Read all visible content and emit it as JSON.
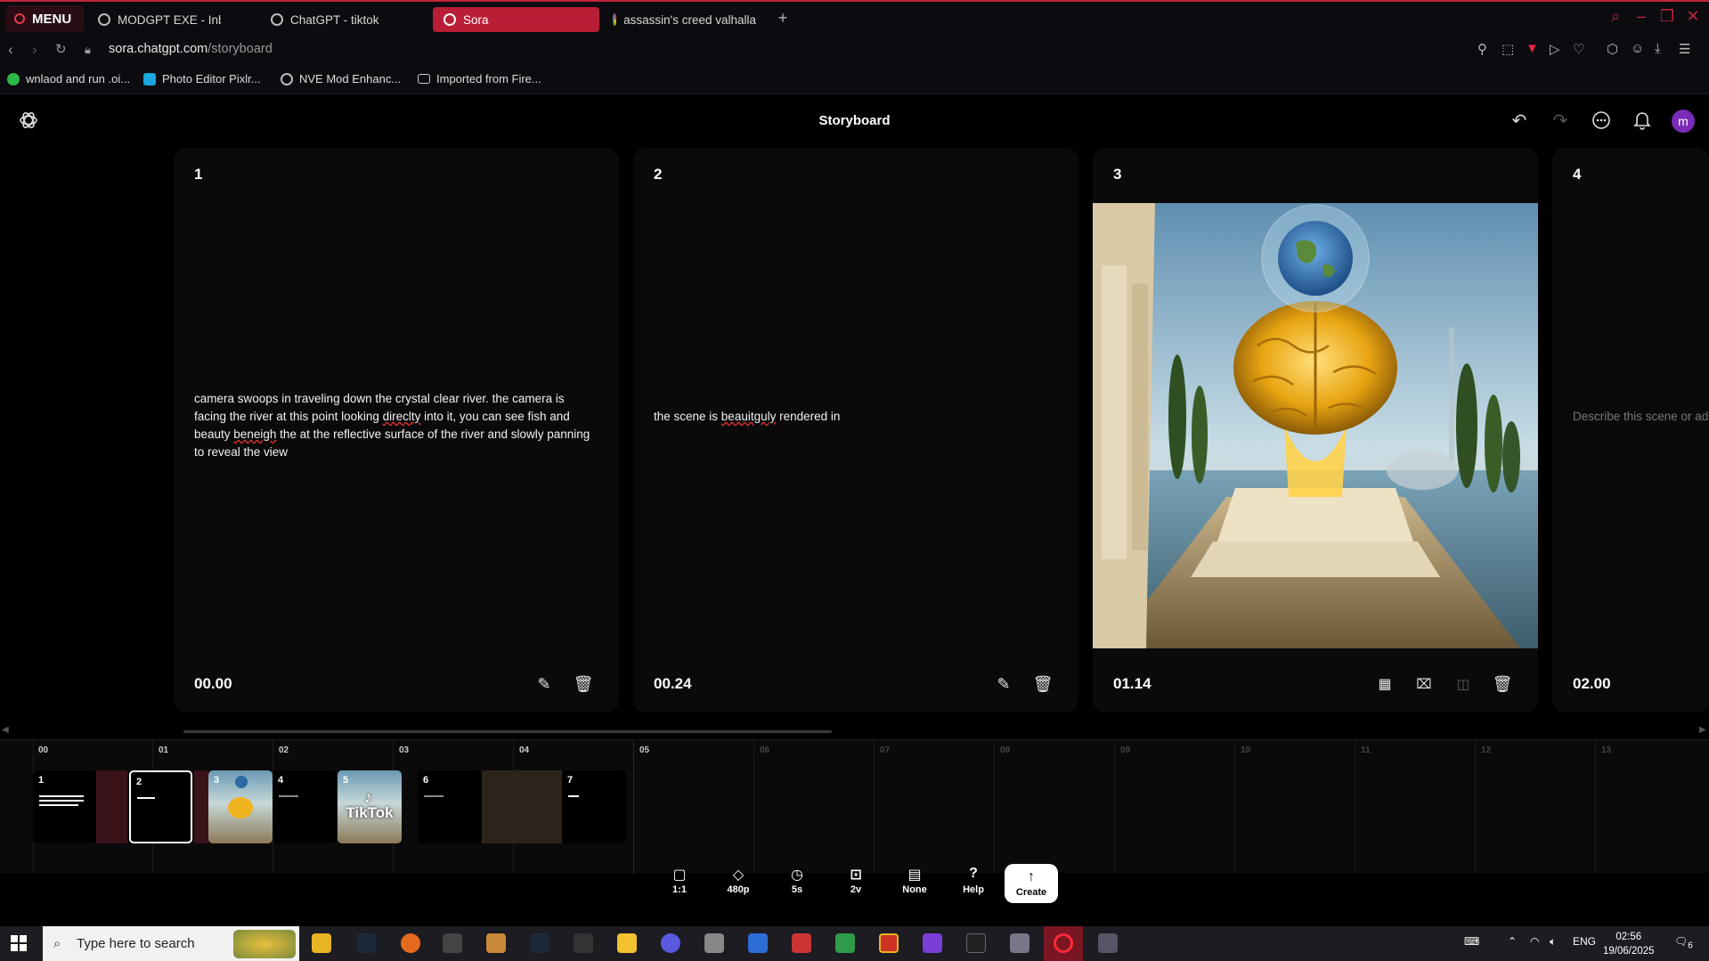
{
  "browser": {
    "menu_label": "MENU",
    "tabs": [
      {
        "title": "MODGPT EXE - Inbox tab"
      },
      {
        "title": "ChatGPT - tiktok"
      },
      {
        "title": "Sora"
      },
      {
        "title": "assassin's creed valhalla"
      }
    ],
    "url_domain": "sora.chatgpt.com",
    "url_path": "/storyboard",
    "bookmarks": [
      {
        "label": "wnlaod and run .oi...",
        "color": "#2fb84a"
      },
      {
        "label": "Photo Editor Pixlr...",
        "color": "#1aa7e0"
      },
      {
        "label": "NVE Mod Enhanc...",
        "color": "#bbbbbb"
      },
      {
        "label": "Imported from Fire...",
        "color": "#cccccc"
      }
    ],
    "accent": "#c0243a"
  },
  "header": {
    "title": "Storyboard",
    "avatar_letter": "m"
  },
  "cards": [
    {
      "number": "1",
      "prompt_parts": [
        "camera swoops in traveling down the crystal clear river. the camera is facing the river at this point looking ",
        "direclty",
        " into it, you can see fish and beauty ",
        "beneigh",
        " the at the reflective surface of the river and slowly panning to reveal the view"
      ],
      "time": "00.00"
    },
    {
      "number": "2",
      "prompt_parts": [
        "the scene is ",
        "beauitguly",
        " rendered in"
      ],
      "time": "00.24"
    },
    {
      "number": "3",
      "image": "golden brain on marble pedestal with earth globe, river and columns",
      "time": "01.14"
    },
    {
      "number": "4",
      "placeholder": "Describe this scene or ad",
      "time": "02.00"
    }
  ],
  "timeline": {
    "ruler": [
      "00",
      "01",
      "02",
      "03",
      "04",
      "05",
      "06",
      "07",
      "08",
      "09",
      "10",
      "11",
      "12",
      "13"
    ],
    "clips": [
      {
        "label": "1"
      },
      {
        "label": "2"
      },
      {
        "label": "3"
      },
      {
        "label": "4"
      },
      {
        "label": "5",
        "overlay": "TikTok"
      },
      {
        "label": "6"
      },
      {
        "label": "7"
      }
    ]
  },
  "toolbar": {
    "items": [
      {
        "label": "1:1",
        "icon": "aspect-ratio-icon"
      },
      {
        "label": "480p",
        "icon": "resolution-icon"
      },
      {
        "label": "5s",
        "icon": "duration-icon"
      },
      {
        "label": "2v",
        "icon": "variations-icon"
      },
      {
        "label": "None",
        "icon": "preset-icon"
      },
      {
        "label": "Help",
        "icon": "help-icon"
      }
    ],
    "create_label": "Create"
  },
  "taskbar": {
    "search_placeholder": "Type here to search",
    "lang": "ENG",
    "time": "02:56",
    "date": "19/06/2025",
    "notifications": "6"
  }
}
